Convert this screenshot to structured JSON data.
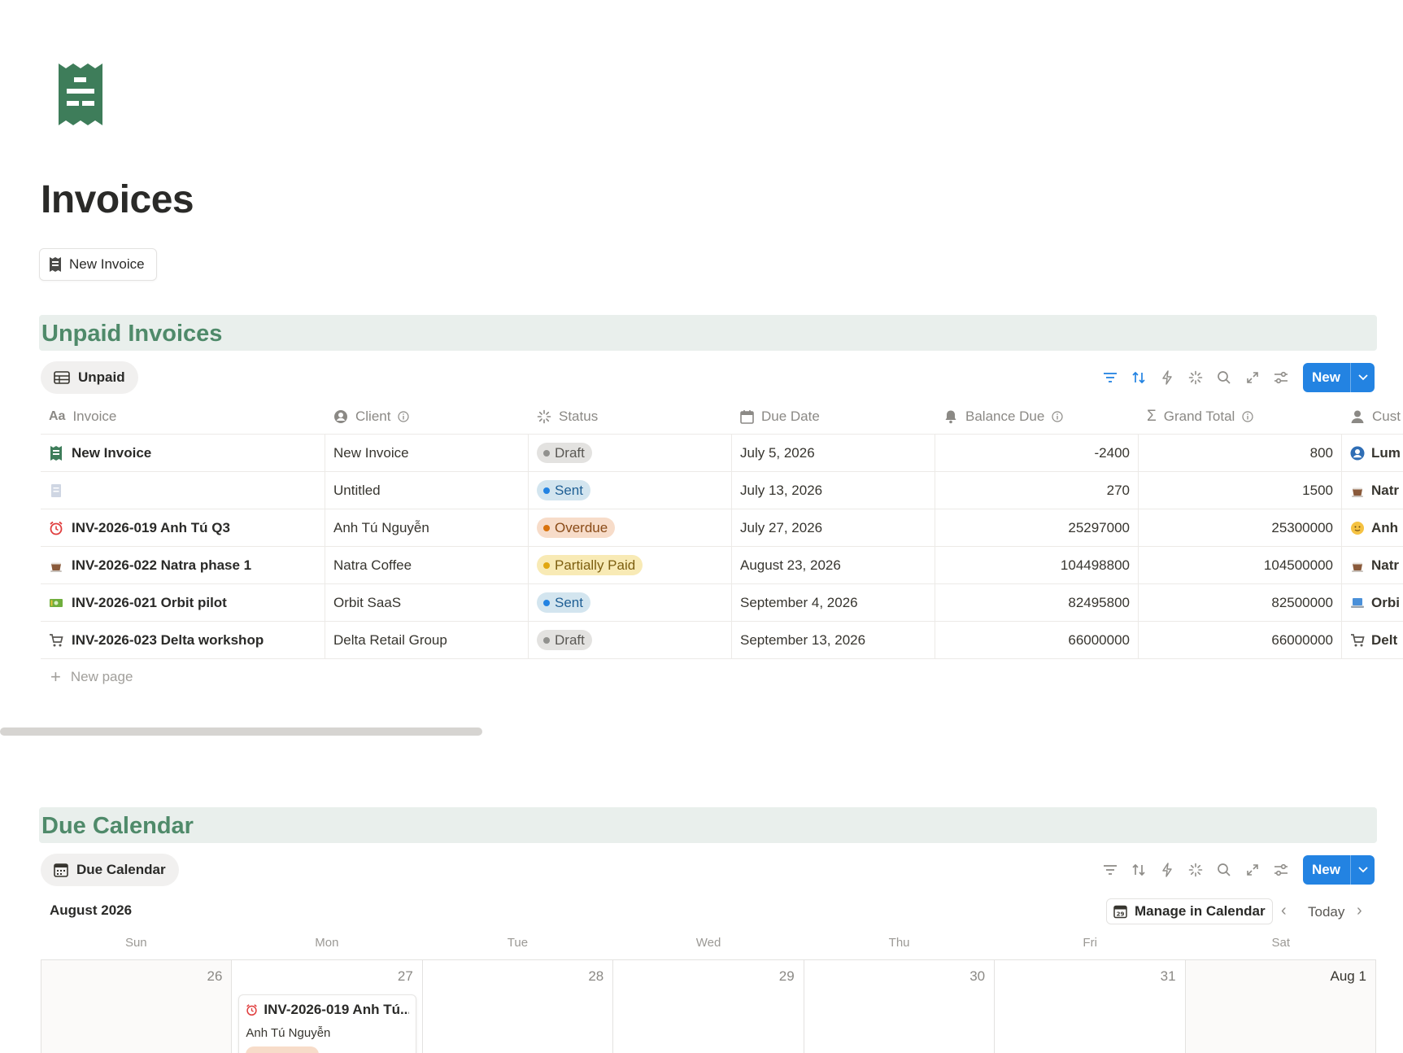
{
  "page": {
    "title": "Invoices",
    "icon": "receipt-icon",
    "new_invoice_button": "New Invoice"
  },
  "colors": {
    "accent_blue": "#2383e2",
    "section_green": "#4f8a6a",
    "section_bg": "#e9efec",
    "icon_green": "#3e7d5a"
  },
  "unpaid": {
    "heading": "Unpaid Invoices",
    "view_tab": "Unpaid",
    "new_button": "New",
    "columns": {
      "invoice": "Invoice",
      "client": "Client",
      "status": "Status",
      "due_date": "Due Date",
      "balance_due": "Balance Due",
      "grand_total": "Grand Total",
      "customer": "Cust"
    },
    "rows": [
      {
        "icon": "receipt-icon",
        "invoice": "New Invoice",
        "client": "New Invoice",
        "status": "Draft",
        "due_date": "July 5, 2026",
        "balance_due": "-2400",
        "grand_total": "800",
        "customer": "Lum",
        "customer_icon": "person-circle-icon"
      },
      {
        "icon": "page-icon",
        "invoice": "",
        "client": "Untitled",
        "status": "Sent",
        "due_date": "July 13, 2026",
        "balance_due": "270",
        "grand_total": "1500",
        "customer": "Natr",
        "customer_icon": "coffee-icon"
      },
      {
        "icon": "alarm-clock-icon",
        "invoice": "INV-2026-019 Anh Tú Q3",
        "client": "Anh Tú Nguyễn",
        "status": "Overdue",
        "due_date": "July 27, 2026",
        "balance_due": "25297000",
        "grand_total": "25300000",
        "customer": "Anh",
        "customer_icon": "smiley-icon"
      },
      {
        "icon": "coffee-icon",
        "invoice": "INV-2026-022 Natra phase 1",
        "client": "Natra Coffee",
        "status": "Partially Paid",
        "due_date": "August 23, 2026",
        "balance_due": "104498800",
        "grand_total": "104500000",
        "customer": "Natr",
        "customer_icon": "coffee-icon"
      },
      {
        "icon": "money-icon",
        "invoice": "INV-2026-021 Orbit pilot",
        "client": "Orbit SaaS",
        "status": "Sent",
        "due_date": "September 4, 2026",
        "balance_due": "82495800",
        "grand_total": "82500000",
        "customer": "Orbi",
        "customer_icon": "laptop-icon"
      },
      {
        "icon": "cart-icon",
        "invoice": "INV-2026-023 Delta workshop",
        "client": "Delta Retail Group",
        "status": "Draft",
        "due_date": "September 13, 2026",
        "balance_due": "66000000",
        "grand_total": "66000000",
        "customer": "Delt",
        "customer_icon": "cart-icon"
      }
    ],
    "status_styles": {
      "Draft": {
        "bg": "#e3e2e0",
        "dot": "#91918e",
        "fg": "#5a5854"
      },
      "Sent": {
        "bg": "#d3e5ef",
        "dot": "#2383e2",
        "fg": "#1f5f94"
      },
      "Overdue": {
        "bg": "#f7dcc9",
        "dot": "#d9730d",
        "fg": "#8a4b17"
      },
      "Partially Paid": {
        "bg": "#f8eab5",
        "dot": "#e0a712",
        "fg": "#7d5f10"
      }
    },
    "new_page_label": "New page"
  },
  "calendar": {
    "heading": "Due Calendar",
    "view_tab": "Due Calendar",
    "new_button": "New",
    "month": "August 2026",
    "manage_button": "Manage in Calendar",
    "today_button": "Today",
    "weekdays": [
      "Sun",
      "Mon",
      "Tue",
      "Wed",
      "Thu",
      "Fri",
      "Sat"
    ],
    "days": [
      "26",
      "27",
      "28",
      "29",
      "30",
      "31",
      "Aug 1"
    ],
    "event": {
      "title": "INV-2026-019 Anh Tú...",
      "client": "Anh Tú Nguyễn",
      "icon": "alarm-clock-icon"
    }
  }
}
